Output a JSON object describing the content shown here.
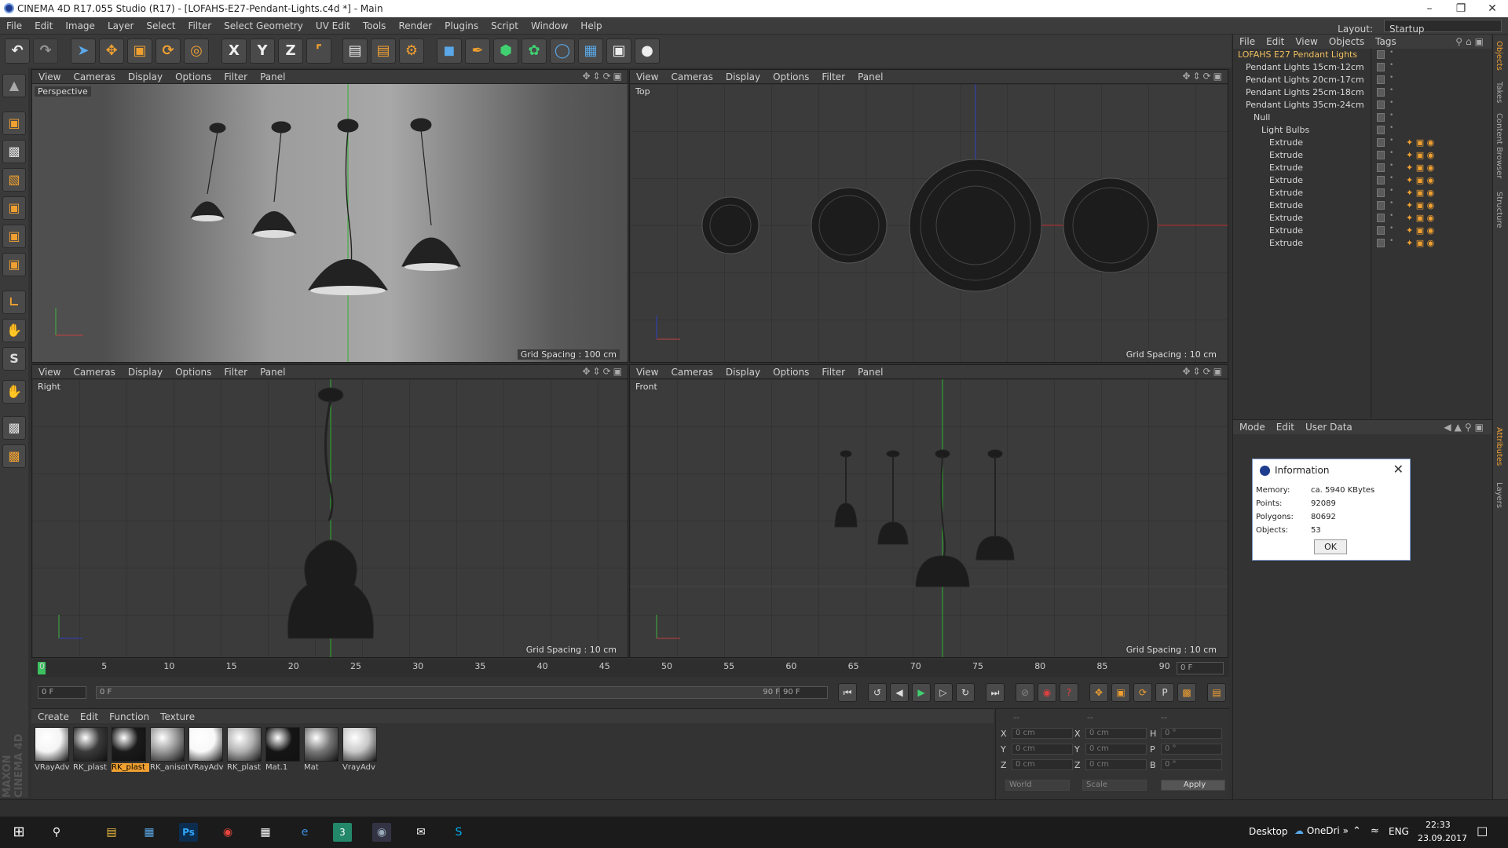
{
  "window": {
    "title": "CINEMA 4D R17.055 Studio (R17) - [LOFAHS-E27-Pendant-Lights.c4d *] - Main"
  },
  "menu": [
    "File",
    "Edit",
    "Image",
    "Layer",
    "Select",
    "Filter",
    "Select Geometry",
    "UV Edit",
    "Tools",
    "Render",
    "Plugins",
    "Script",
    "Window",
    "Help"
  ],
  "layout": {
    "label": "Layout:",
    "value": "Startup"
  },
  "viewport_menu": [
    "View",
    "Cameras",
    "Display",
    "Options",
    "Filter",
    "Panel"
  ],
  "viewports": {
    "perspective": {
      "name": "Perspective",
      "grid": "Grid Spacing : 100 cm"
    },
    "top": {
      "name": "Top",
      "grid": "Grid Spacing : 10 cm"
    },
    "right": {
      "name": "Right",
      "grid": "Grid Spacing : 10 cm"
    },
    "front": {
      "name": "Front",
      "grid": "Grid Spacing : 10 cm"
    }
  },
  "objects": {
    "menu": [
      "File",
      "Edit",
      "View",
      "Objects",
      "Tags"
    ],
    "tree": [
      {
        "label": "LOFAHS E27 Pendant Lights",
        "level": 0,
        "highlight": true
      },
      {
        "label": "Pendant Lights 15cm-12cm",
        "level": 1
      },
      {
        "label": "Pendant Lights 20cm-17cm",
        "level": 1
      },
      {
        "label": "Pendant Lights 25cm-18cm",
        "level": 1
      },
      {
        "label": "Pendant Lights 35cm-24cm",
        "level": 1
      },
      {
        "label": "Null",
        "level": 2
      },
      {
        "label": "Light Bulbs",
        "level": 3
      },
      {
        "label": "Extrude",
        "level": 4
      },
      {
        "label": "Extrude",
        "level": 4
      },
      {
        "label": "Extrude",
        "level": 4
      },
      {
        "label": "Extrude",
        "level": 4
      },
      {
        "label": "Extrude",
        "level": 4
      },
      {
        "label": "Extrude",
        "level": 4
      },
      {
        "label": "Extrude",
        "level": 4
      },
      {
        "label": "Extrude",
        "level": 4
      },
      {
        "label": "Extrude",
        "level": 4
      }
    ]
  },
  "attributes": {
    "menu": [
      "Mode",
      "Edit",
      "User Data"
    ]
  },
  "right_tabs": [
    "Objects",
    "Takes",
    "Content Browser",
    "Structure",
    "Attributes",
    "Layers"
  ],
  "dialog": {
    "title": "Information",
    "rows": [
      {
        "label": "Memory:",
        "value": "ca. 5940 KBytes"
      },
      {
        "label": "Points:",
        "value": "92089"
      },
      {
        "label": "Polygons:",
        "value": "80692"
      },
      {
        "label": "Objects:",
        "value": "53"
      }
    ],
    "ok": "OK"
  },
  "timeline": {
    "ticks": [
      "0",
      "5",
      "10",
      "15",
      "20",
      "25",
      "30",
      "35",
      "40",
      "45",
      "50",
      "55",
      "60",
      "65",
      "70",
      "75",
      "80",
      "85",
      "90"
    ],
    "current": "0 F",
    "start": "0 F",
    "range_start": "0 F",
    "range_end": "90 F",
    "end": "90 F"
  },
  "materials": {
    "menu": [
      "Create",
      "Edit",
      "Function",
      "Texture"
    ],
    "items": [
      {
        "label": "VRayAdv",
        "color": "#f4f4f4"
      },
      {
        "label": "RK_plast",
        "color": "#3a3a3a"
      },
      {
        "label": "RK_plast",
        "color": "#1a1a1a",
        "selected": true
      },
      {
        "label": "RK_anisot",
        "color": "#9a9a9a"
      },
      {
        "label": "VRayAdv",
        "color": "#f8f8f8"
      },
      {
        "label": "RK_plast",
        "color": "#b0b0b0"
      },
      {
        "label": "Mat.1",
        "color": "#151515"
      },
      {
        "label": "Mat",
        "color": "#777777"
      },
      {
        "label": "VrayAdv",
        "color": "#c8c8c8"
      }
    ]
  },
  "coords": {
    "header": [
      "--",
      "--",
      "--"
    ],
    "rows": [
      {
        "a": "X",
        "av": "0 cm",
        "b": "X",
        "bv": "0 cm",
        "c": "H",
        "cv": "0 °"
      },
      {
        "a": "Y",
        "av": "0 cm",
        "b": "Y",
        "bv": "0 cm",
        "c": "P",
        "cv": "0 °"
      },
      {
        "a": "Z",
        "av": "0 cm",
        "b": "Z",
        "bv": "0 cm",
        "c": "B",
        "cv": "0 °"
      }
    ],
    "world": "World",
    "scale": "Scale",
    "apply": "Apply"
  },
  "brand": "MAXON CINEMA 4D",
  "taskbar": {
    "desktop": "Desktop",
    "onedrive": "OneDri",
    "lang": "ENG",
    "time": "22:33",
    "date": "23.09.2017"
  },
  "colors": {
    "accent": "#f0a030",
    "highlight_text": "#f0c060",
    "selection": "#2f6ab0"
  }
}
